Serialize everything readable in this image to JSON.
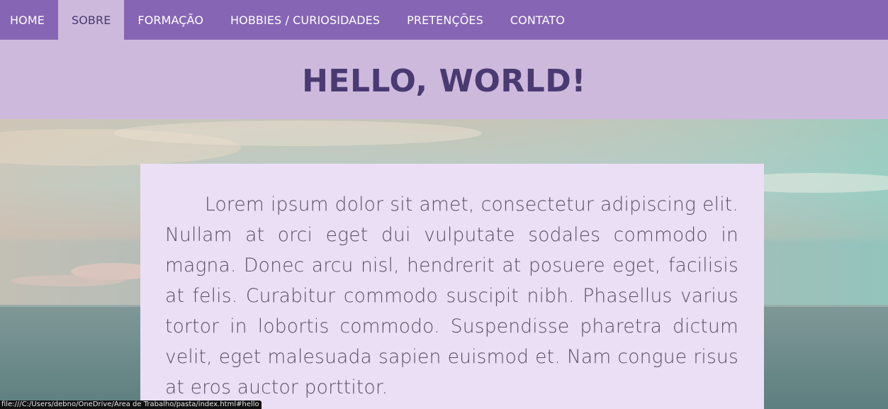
{
  "nav": {
    "items": [
      {
        "label": "HOME",
        "active": false
      },
      {
        "label": "SOBRE",
        "active": true
      },
      {
        "label": "FORMAÇÃO",
        "active": false
      },
      {
        "label": "HOBBIES / CURIOSIDADES",
        "active": false
      },
      {
        "label": "PRETENÇÕES",
        "active": false
      },
      {
        "label": "CONTATO",
        "active": false
      }
    ]
  },
  "header": {
    "title": "HELLO, WORLD!"
  },
  "main": {
    "paragraph": "Lorem ipsum dolor sit amet, consectetur adipiscing elit. Nullam at orci eget dui vulputate sodales commodo in magna. Donec arcu nisl, hendrerit at posuere eget, facilisis at felis. Curabitur commodo suscipit nibh. Phasellus varius tortor in lobortis commodo. Suspendisse pharetra dictum velit, eget malesuada sapien euismod et. Nam congue risus at eros auctor porttitor."
  },
  "status_bar": {
    "url": "file:///C:/Users/debno/OneDrive/Área de Trabalho/pasta/index.html#hello"
  },
  "colors": {
    "nav_bg": "#8665b4",
    "nav_active_bg": "#cdb9dc",
    "header_bg": "#cdb9dc",
    "title_color": "#4a3a72",
    "card_bg": "#ebdff5",
    "text_color": "#5a4f66"
  }
}
